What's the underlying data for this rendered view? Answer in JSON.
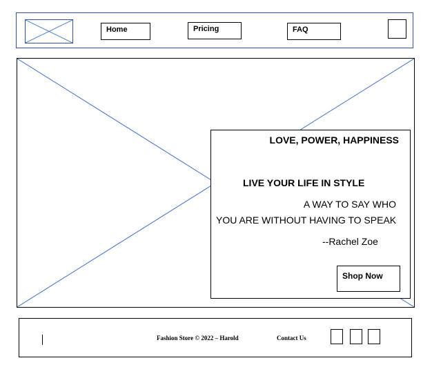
{
  "header": {
    "nav": {
      "home": "Home",
      "pricing": "Pricing",
      "faq": "FAQ"
    }
  },
  "hero": {
    "tagline": "LOVE, POWER, HAPPINESS",
    "headline": "LIVE YOUR LIFE IN STYLE",
    "quote_line1": "A WAY TO SAY WHO",
    "quote_line2": "YOU ARE WITHOUT HAVING TO SPEAK",
    "quote_author": "--Rachel Zoe",
    "cta_label": "Shop Now"
  },
  "footer": {
    "copyright": "Fashion Store © 2022 – Harold",
    "contact": "Contact Us"
  },
  "colors": {
    "placeholder_stroke": "#4472c4",
    "header_border": "#2f5597"
  }
}
